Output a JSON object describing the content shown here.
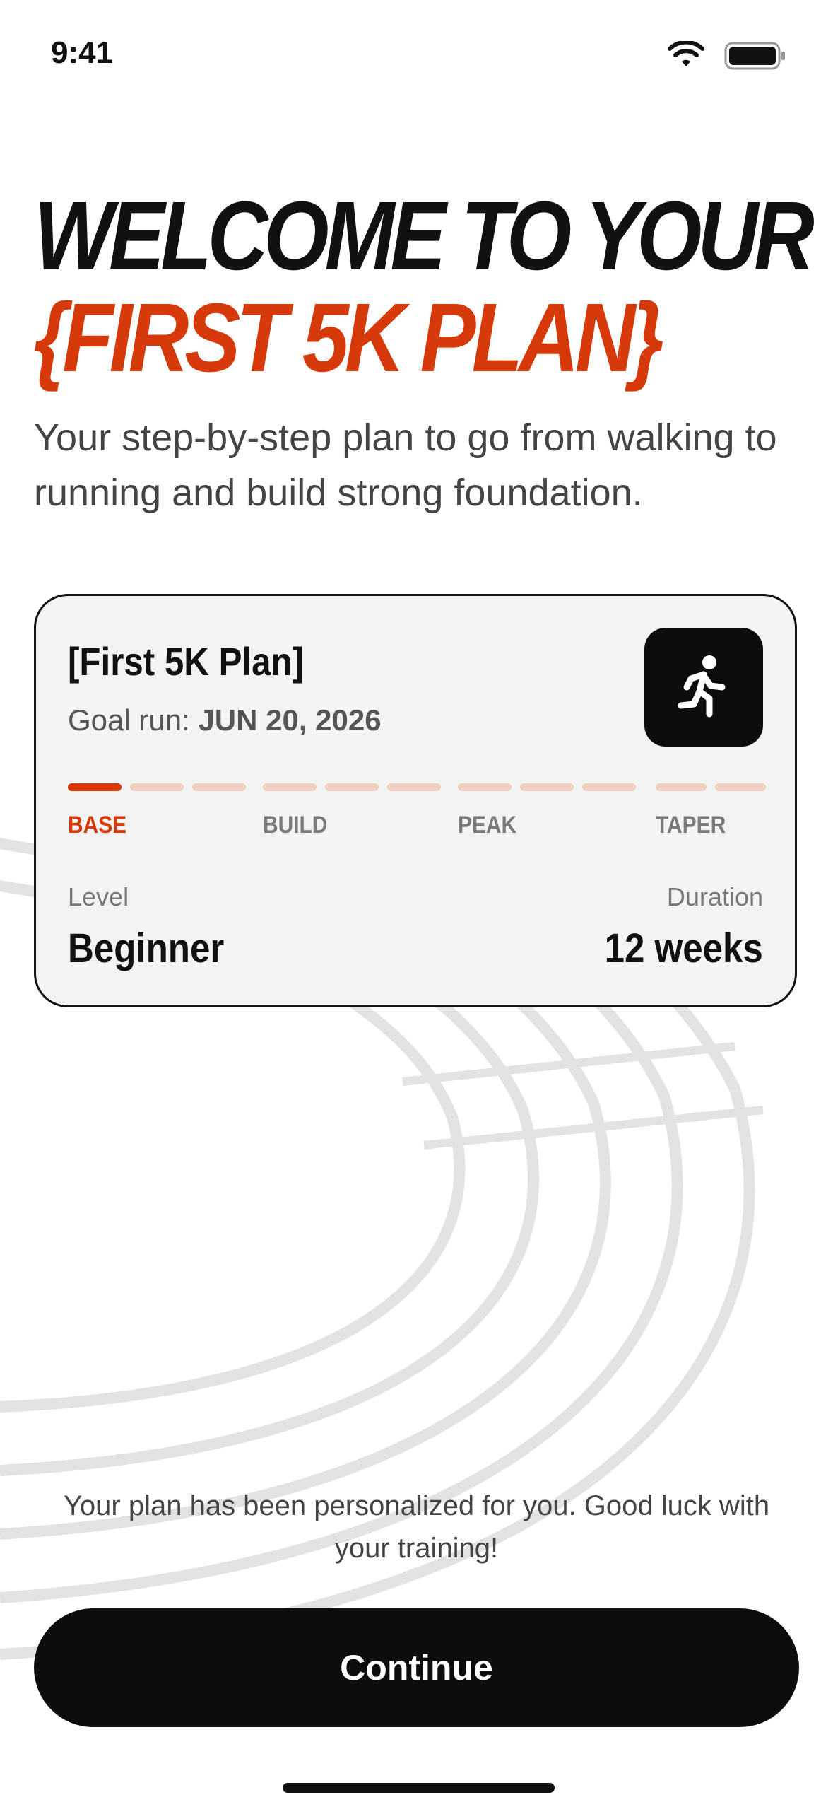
{
  "status_bar": {
    "time": "9:41"
  },
  "headline": {
    "line1": "WELCOME TO YOUR",
    "line2": "{FIRST 5K PLAN}"
  },
  "subtitle": "Your step-by-step plan to go from walking to running and build strong foundation.",
  "plan_card": {
    "title": "[First 5K Plan]",
    "goal_prefix": "Goal run: ",
    "goal_date": "JUN 20, 2026",
    "phases": [
      "BASE",
      "BUILD",
      "PEAK",
      "TAPER"
    ],
    "active_phase": "BASE",
    "progress_segments_filled": 1,
    "progress_segments_total": 11,
    "level_label": "Level",
    "level_value": "Beginner",
    "duration_label": "Duration",
    "duration_value": "12 weeks",
    "icon": "running-person-icon"
  },
  "footer_note": "Your plan has been personalized for you. Good luck with your training!",
  "continue_button": {
    "label": "Continue"
  },
  "colors": {
    "accent": "#D63A0A",
    "accent_light": "#F2CFC3",
    "dark": "#0D0D0D",
    "card_bg": "#F3F3F3"
  }
}
